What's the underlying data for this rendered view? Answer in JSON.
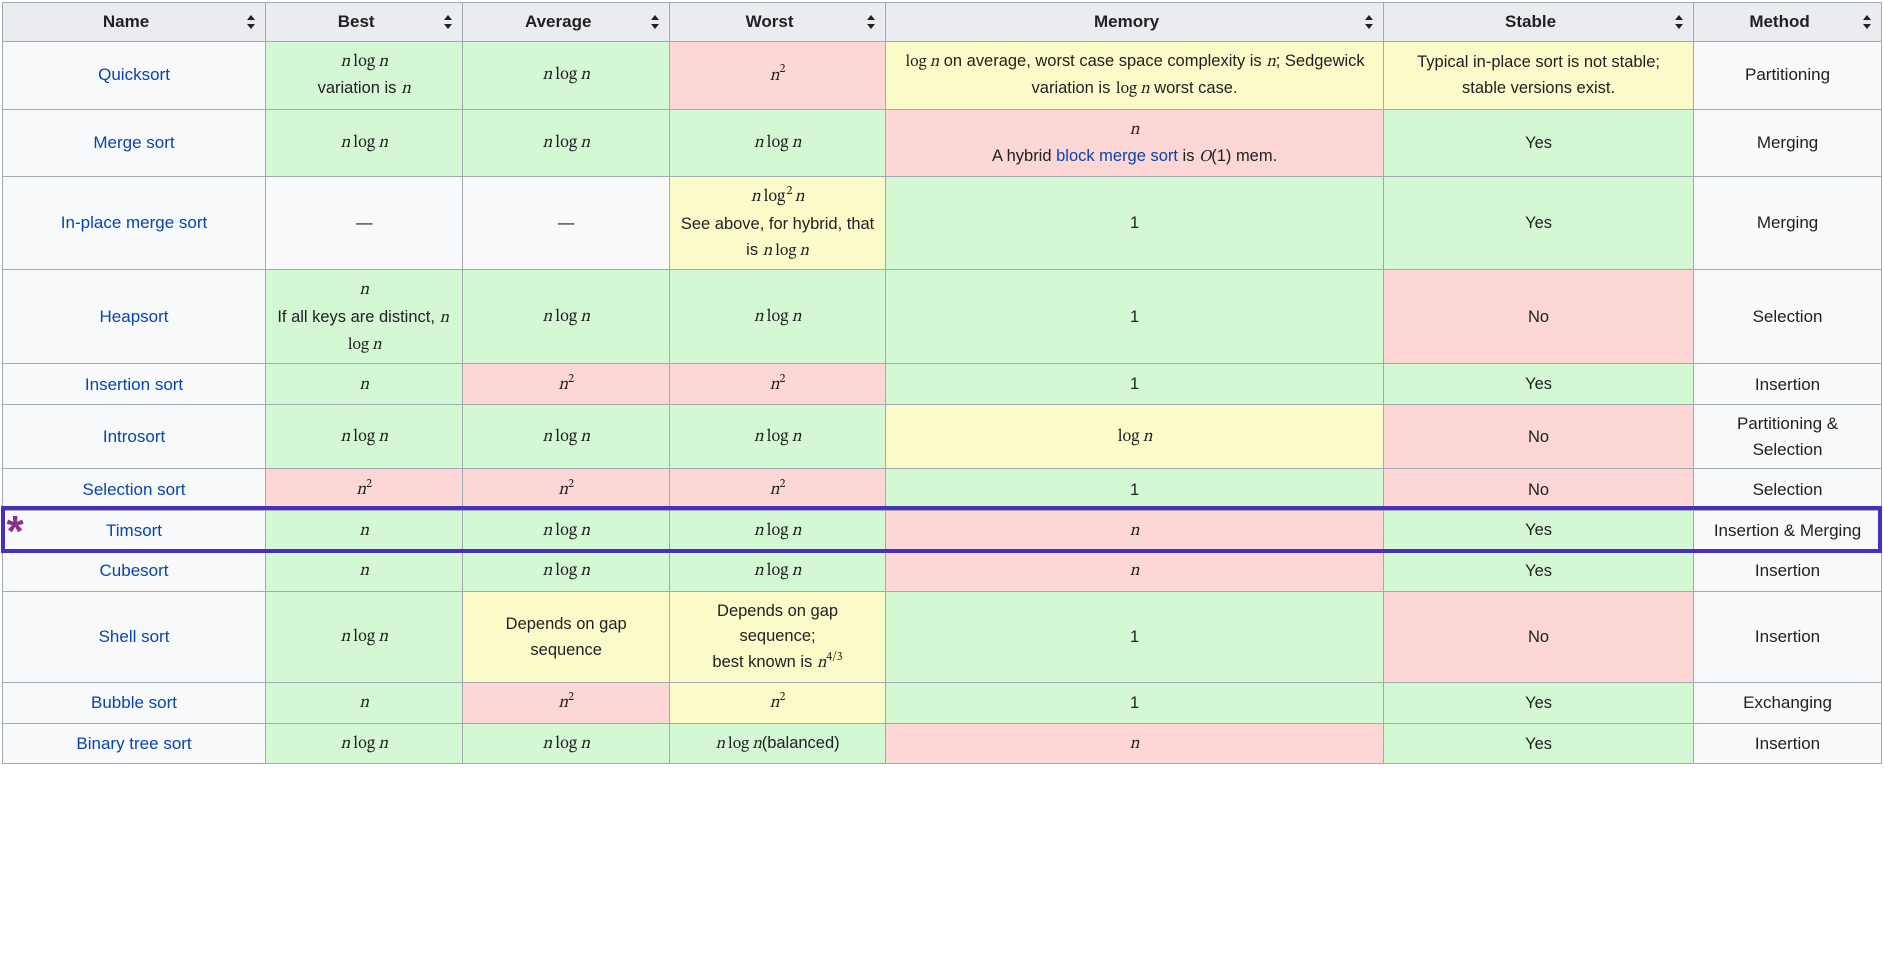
{
  "headers": [
    "Name",
    "Best",
    "Average",
    "Worst",
    "Memory",
    "Stable",
    "Method"
  ],
  "colors": {
    "green": "#d4f7d4",
    "red": "#fdd6d6",
    "yellow": "#fbfbc9",
    "gray": "#f8f9fa",
    "link": "#0645ad",
    "highlight_border": "#4a2fbf",
    "star": "#8a2f8a"
  },
  "highlight": {
    "row_name": "Timsort",
    "star_glyph": "*"
  },
  "chart_data": {
    "type": "table",
    "title": "Comparison sorting algorithms",
    "columns": [
      "Name",
      "Best",
      "Average",
      "Worst",
      "Memory",
      "Stable",
      "Method"
    ],
    "rows": [
      {
        "Name": "Quicksort",
        "Best": "n log n (variation is n)",
        "Average": "n log n",
        "Worst": "n^2",
        "Memory": "log n on average, worst case space complexity is n; Sedgewick variation is log n worst case.",
        "Stable": "Typical in-place sort is not stable; stable versions exist.",
        "Method": "Partitioning"
      },
      {
        "Name": "Merge sort",
        "Best": "n log n",
        "Average": "n log n",
        "Worst": "n log n",
        "Memory": "n — A hybrid block merge sort is O(1) mem.",
        "Stable": "Yes",
        "Method": "Merging"
      },
      {
        "Name": "In-place merge sort",
        "Best": "—",
        "Average": "—",
        "Worst": "n log^2 n — See above, for hybrid, that is n log n",
        "Memory": "1",
        "Stable": "Yes",
        "Method": "Merging"
      },
      {
        "Name": "Heapsort",
        "Best": "n — If all keys are distinct, n log n",
        "Average": "n log n",
        "Worst": "n log n",
        "Memory": "1",
        "Stable": "No",
        "Method": "Selection"
      },
      {
        "Name": "Insertion sort",
        "Best": "n",
        "Average": "n^2",
        "Worst": "n^2",
        "Memory": "1",
        "Stable": "Yes",
        "Method": "Insertion"
      },
      {
        "Name": "Introsort",
        "Best": "n log n",
        "Average": "n log n",
        "Worst": "n log n",
        "Memory": "log n",
        "Stable": "No",
        "Method": "Partitioning & Selection"
      },
      {
        "Name": "Selection sort",
        "Best": "n^2",
        "Average": "n^2",
        "Worst": "n^2",
        "Memory": "1",
        "Stable": "No",
        "Method": "Selection"
      },
      {
        "Name": "Timsort",
        "Best": "n",
        "Average": "n log n",
        "Worst": "n log n",
        "Memory": "n",
        "Stable": "Yes",
        "Method": "Insertion & Merging"
      },
      {
        "Name": "Cubesort",
        "Best": "n",
        "Average": "n log n",
        "Worst": "n log n",
        "Memory": "n",
        "Stable": "Yes",
        "Method": "Insertion"
      },
      {
        "Name": "Shell sort",
        "Best": "n log n",
        "Average": "Depends on gap sequence",
        "Worst": "Depends on gap sequence; best known is n^(4/3)",
        "Memory": "1",
        "Stable": "No",
        "Method": "Insertion"
      },
      {
        "Name": "Bubble sort",
        "Best": "n",
        "Average": "n^2",
        "Worst": "n^2",
        "Memory": "1",
        "Stable": "Yes",
        "Method": "Exchanging"
      },
      {
        "Name": "Binary tree sort",
        "Best": "n log n",
        "Average": "n log n",
        "Worst": "n log n (balanced)",
        "Memory": "n",
        "Stable": "Yes",
        "Method": "Insertion"
      }
    ]
  },
  "rows": [
    {
      "name": "Quicksort",
      "best": {
        "color": "green",
        "parts": [
          {
            "t": "math",
            "v": "n log n"
          },
          {
            "t": "note",
            "v": "variation is "
          },
          {
            "t": "math_inline",
            "v": "n"
          }
        ]
      },
      "avg": {
        "color": "green",
        "parts": [
          {
            "t": "math",
            "v": "n log n"
          }
        ]
      },
      "worst": {
        "color": "red",
        "parts": [
          {
            "t": "math",
            "v": "n^2"
          }
        ]
      },
      "mem": {
        "color": "yellow",
        "parts": [
          {
            "t": "mix",
            "segments": [
              {
                "k": "m",
                "v": "log n"
              },
              {
                "k": "txt",
                "v": " on average, worst case space complexity is "
              },
              {
                "k": "m",
                "v": "n"
              },
              {
                "k": "txt",
                "v": "; Sedgewick variation is "
              },
              {
                "k": "m",
                "v": "log n"
              },
              {
                "k": "txt",
                "v": " worst case."
              }
            ]
          }
        ]
      },
      "stable": {
        "color": "yellow",
        "parts": [
          {
            "t": "text",
            "v": "Typical in-place sort is not stable; stable versions exist."
          }
        ]
      },
      "method": "Partitioning"
    },
    {
      "name": "Merge sort",
      "best": {
        "color": "green",
        "parts": [
          {
            "t": "math",
            "v": "n log n"
          }
        ]
      },
      "avg": {
        "color": "green",
        "parts": [
          {
            "t": "math",
            "v": "n log n"
          }
        ]
      },
      "worst": {
        "color": "green",
        "parts": [
          {
            "t": "math",
            "v": "n log n"
          }
        ]
      },
      "mem": {
        "color": "red",
        "parts": [
          {
            "t": "math",
            "v": "n"
          },
          {
            "t": "mix",
            "segments": [
              {
                "k": "txt",
                "v": "A hybrid "
              },
              {
                "k": "link",
                "v": "block merge sort"
              },
              {
                "k": "txt",
                "v": " is "
              },
              {
                "k": "mO",
                "v": "O"
              },
              {
                "k": "txt",
                "v": "(1) mem."
              }
            ]
          }
        ]
      },
      "stable": {
        "color": "green",
        "parts": [
          {
            "t": "text",
            "v": "Yes"
          }
        ]
      },
      "method": "Merging"
    },
    {
      "name": "In-place merge sort",
      "best": {
        "color": "gray",
        "parts": [
          {
            "t": "text",
            "v": "—"
          }
        ]
      },
      "avg": {
        "color": "gray",
        "parts": [
          {
            "t": "text",
            "v": "—"
          }
        ]
      },
      "worst": {
        "color": "yellow",
        "parts": [
          {
            "t": "math",
            "v": "n log^2 n"
          },
          {
            "t": "mix",
            "segments": [
              {
                "k": "txt",
                "v": "See above, for hybrid, that is "
              },
              {
                "k": "m",
                "v": "n log n"
              }
            ]
          }
        ]
      },
      "mem": {
        "color": "green",
        "parts": [
          {
            "t": "text",
            "v": "1"
          }
        ]
      },
      "stable": {
        "color": "green",
        "parts": [
          {
            "t": "text",
            "v": "Yes"
          }
        ]
      },
      "method": "Merging"
    },
    {
      "name": "Heapsort",
      "best": {
        "color": "green",
        "parts": [
          {
            "t": "math",
            "v": "n"
          },
          {
            "t": "mix",
            "segments": [
              {
                "k": "txt",
                "v": "If all keys are distinct, "
              },
              {
                "k": "m",
                "v": "n log n"
              }
            ]
          }
        ]
      },
      "avg": {
        "color": "green",
        "parts": [
          {
            "t": "math",
            "v": "n log n"
          }
        ]
      },
      "worst": {
        "color": "green",
        "parts": [
          {
            "t": "math",
            "v": "n log n"
          }
        ]
      },
      "mem": {
        "color": "green",
        "parts": [
          {
            "t": "text",
            "v": "1"
          }
        ]
      },
      "stable": {
        "color": "red",
        "parts": [
          {
            "t": "text",
            "v": "No"
          }
        ]
      },
      "method": "Selection"
    },
    {
      "name": "Insertion sort",
      "best": {
        "color": "green",
        "parts": [
          {
            "t": "math",
            "v": "n"
          }
        ]
      },
      "avg": {
        "color": "red",
        "parts": [
          {
            "t": "math",
            "v": "n^2"
          }
        ]
      },
      "worst": {
        "color": "red",
        "parts": [
          {
            "t": "math",
            "v": "n^2"
          }
        ]
      },
      "mem": {
        "color": "green",
        "parts": [
          {
            "t": "text",
            "v": "1"
          }
        ]
      },
      "stable": {
        "color": "green",
        "parts": [
          {
            "t": "text",
            "v": "Yes"
          }
        ]
      },
      "method": "Insertion"
    },
    {
      "name": "Introsort",
      "best": {
        "color": "green",
        "parts": [
          {
            "t": "math",
            "v": "n log n"
          }
        ]
      },
      "avg": {
        "color": "green",
        "parts": [
          {
            "t": "math",
            "v": "n log n"
          }
        ]
      },
      "worst": {
        "color": "green",
        "parts": [
          {
            "t": "math",
            "v": "n log n"
          }
        ]
      },
      "mem": {
        "color": "yellow",
        "parts": [
          {
            "t": "math",
            "v": "log n"
          }
        ]
      },
      "stable": {
        "color": "red",
        "parts": [
          {
            "t": "text",
            "v": "No"
          }
        ]
      },
      "method": "Partitioning & Selection"
    },
    {
      "name": "Selection sort",
      "best": {
        "color": "red",
        "parts": [
          {
            "t": "math",
            "v": "n^2"
          }
        ]
      },
      "avg": {
        "color": "red",
        "parts": [
          {
            "t": "math",
            "v": "n^2"
          }
        ]
      },
      "worst": {
        "color": "red",
        "parts": [
          {
            "t": "math",
            "v": "n^2"
          }
        ]
      },
      "mem": {
        "color": "green",
        "parts": [
          {
            "t": "text",
            "v": "1"
          }
        ]
      },
      "stable": {
        "color": "red",
        "parts": [
          {
            "t": "text",
            "v": "No"
          }
        ]
      },
      "method": "Selection"
    },
    {
      "name": "Timsort",
      "best": {
        "color": "green",
        "parts": [
          {
            "t": "math",
            "v": "n"
          }
        ]
      },
      "avg": {
        "color": "green",
        "parts": [
          {
            "t": "math",
            "v": "n log n"
          }
        ]
      },
      "worst": {
        "color": "green",
        "parts": [
          {
            "t": "math",
            "v": "n log n"
          }
        ]
      },
      "mem": {
        "color": "red",
        "parts": [
          {
            "t": "math",
            "v": "n"
          }
        ]
      },
      "stable": {
        "color": "green",
        "parts": [
          {
            "t": "text",
            "v": "Yes"
          }
        ]
      },
      "method": "Insertion & Merging"
    },
    {
      "name": "Cubesort",
      "best": {
        "color": "green",
        "parts": [
          {
            "t": "math",
            "v": "n"
          }
        ]
      },
      "avg": {
        "color": "green",
        "parts": [
          {
            "t": "math",
            "v": "n log n"
          }
        ]
      },
      "worst": {
        "color": "green",
        "parts": [
          {
            "t": "math",
            "v": "n log n"
          }
        ]
      },
      "mem": {
        "color": "red",
        "parts": [
          {
            "t": "math",
            "v": "n"
          }
        ]
      },
      "stable": {
        "color": "green",
        "parts": [
          {
            "t": "text",
            "v": "Yes"
          }
        ]
      },
      "method": "Insertion"
    },
    {
      "name": "Shell sort",
      "best": {
        "color": "green",
        "parts": [
          {
            "t": "math",
            "v": "n log n"
          }
        ]
      },
      "avg": {
        "color": "yellow",
        "parts": [
          {
            "t": "text",
            "v": "Depends on gap sequence"
          }
        ]
      },
      "worst": {
        "color": "yellow",
        "parts": [
          {
            "t": "text",
            "v": "Depends on gap sequence;"
          },
          {
            "t": "mix",
            "segments": [
              {
                "k": "txt",
                "v": "best known is "
              },
              {
                "k": "m",
                "v": "n^{4/3}"
              }
            ]
          }
        ]
      },
      "mem": {
        "color": "green",
        "parts": [
          {
            "t": "text",
            "v": "1"
          }
        ]
      },
      "stable": {
        "color": "red",
        "parts": [
          {
            "t": "text",
            "v": "No"
          }
        ]
      },
      "method": "Insertion"
    },
    {
      "name": "Bubble sort",
      "best": {
        "color": "green",
        "parts": [
          {
            "t": "math",
            "v": "n"
          }
        ]
      },
      "avg": {
        "color": "red",
        "parts": [
          {
            "t": "math",
            "v": "n^2"
          }
        ]
      },
      "worst": {
        "color": "yellow",
        "parts": [
          {
            "t": "math",
            "v": "n^2"
          }
        ]
      },
      "mem": {
        "color": "green",
        "parts": [
          {
            "t": "text",
            "v": "1"
          }
        ]
      },
      "stable": {
        "color": "green",
        "parts": [
          {
            "t": "text",
            "v": "Yes"
          }
        ]
      },
      "method": "Exchanging"
    },
    {
      "name": "Binary tree sort",
      "best": {
        "color": "green",
        "parts": [
          {
            "t": "math",
            "v": "n log n"
          }
        ]
      },
      "avg": {
        "color": "green",
        "parts": [
          {
            "t": "math",
            "v": "n log n"
          }
        ]
      },
      "worst": {
        "color": "green",
        "parts": [
          {
            "t": "mix",
            "segments": [
              {
                "k": "m",
                "v": "n log n"
              },
              {
                "k": "txt",
                "v": "(balanced)"
              }
            ]
          }
        ]
      },
      "mem": {
        "color": "red",
        "parts": [
          {
            "t": "math",
            "v": "n"
          }
        ]
      },
      "stable": {
        "color": "green",
        "parts": [
          {
            "t": "text",
            "v": "Yes"
          }
        ]
      },
      "method": "Insertion"
    }
  ]
}
